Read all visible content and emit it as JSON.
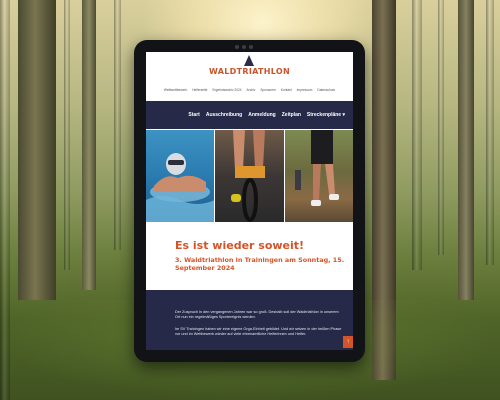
{
  "site": {
    "logo_text": "WALDTRIATHLON",
    "top_nav": [
      "Weiltwettbewerb",
      "Helferseite",
      "Ergebnisarchiv 2024",
      "Archiv",
      "Sponsoren",
      "Kontakt",
      "Impressum",
      "Datenschutz"
    ],
    "main_nav": [
      "Start",
      "Ausschreibung",
      "Anmeldung",
      "Zeitplan",
      "Streckenpläne ▾"
    ],
    "headline": "Es ist wieder soweit!",
    "subheadline": "3. Waldtriathlon in Trainingen am Sonntag, 15. September 2024",
    "paragraph_1": "Der Zuspruch in den vergangenen Jahren war so groß: Deshalb soll der Waldtriathlon in unserem Ort nun ein regelmäßiges Sportereignis werden.",
    "paragraph_2": "Im SV Trainingen haben wir eine eigene Orga-Einheit gebildet. Und wir setzen in der heißen Phase vor und im Wettbewerb wieder auf viele ehrenamtliche Helferinnen und Helfer.",
    "scroll_top_glyph": "↑"
  },
  "colors": {
    "accent": "#d4542a",
    "navy": "#262a48"
  }
}
